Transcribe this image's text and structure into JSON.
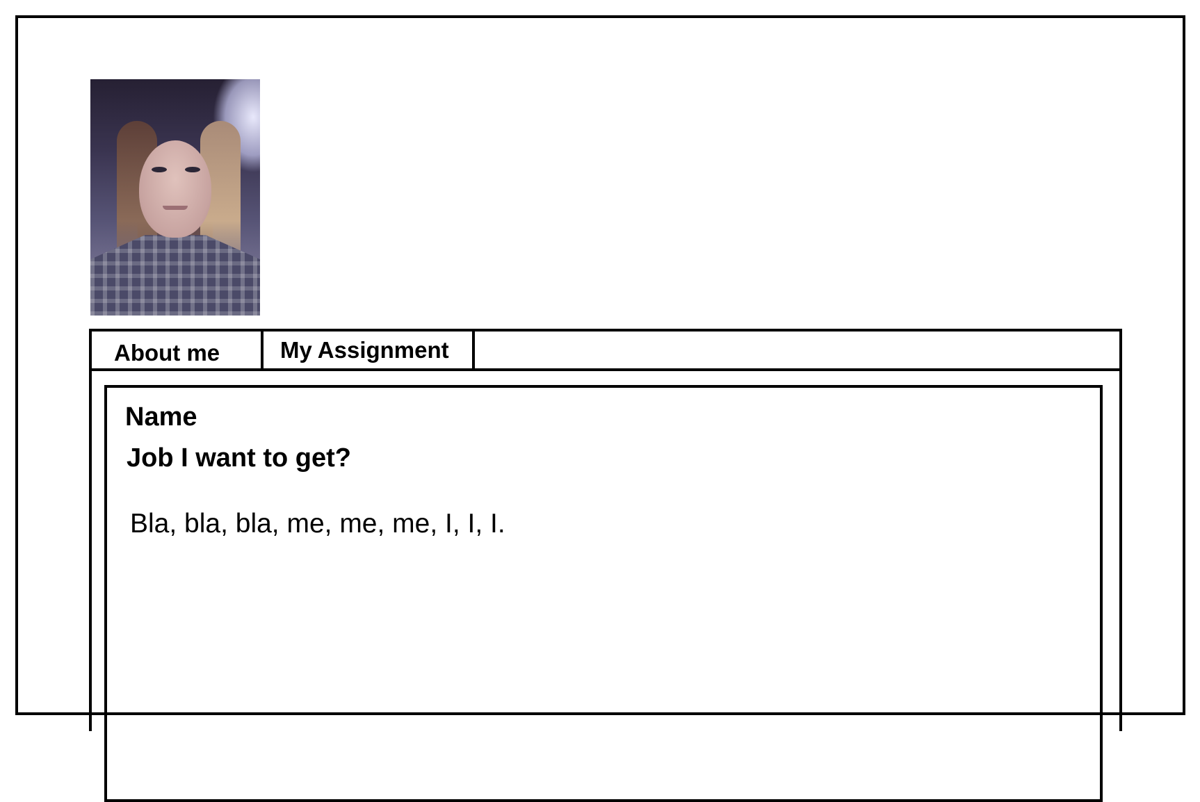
{
  "profile": {
    "photo_alt": "profile-photo"
  },
  "tabs": [
    {
      "label": "About me"
    },
    {
      "label": "My Assignment"
    }
  ],
  "about": {
    "name": "Name",
    "job": "Job I want to get?",
    "bio": "Bla, bla, bla, me, me, me, I, I, I."
  }
}
